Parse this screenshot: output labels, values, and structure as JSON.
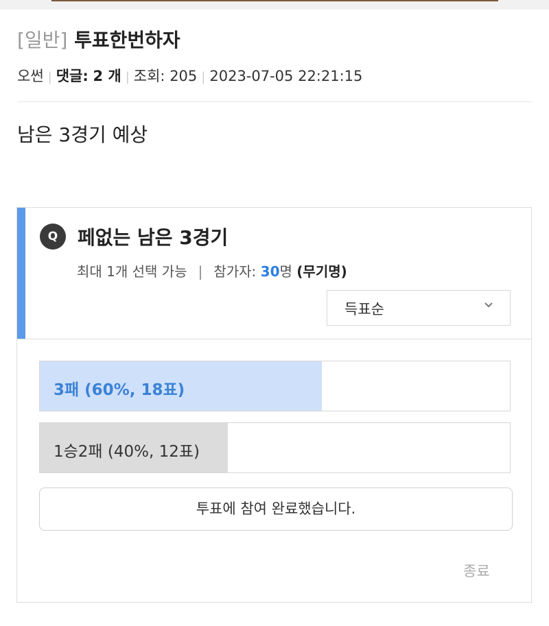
{
  "post": {
    "category": "[일반]",
    "title": "투표한번하자",
    "author": "오썬",
    "comments_label": "댓글:",
    "comments_count": "2 개",
    "views_label": "조회:",
    "views": "205",
    "datetime": "2023-07-05 22:21:15",
    "body": "남은 3경기 예상"
  },
  "poll": {
    "badge": "Q",
    "question": "페없는 남은 3경기",
    "max_select": "최대 1개 선택 가능",
    "divider": "|",
    "participants_label": "참가자:",
    "participants_count": "30",
    "participants_unit": "명",
    "anonymous": "(무기명)",
    "sort_selected": "득표순",
    "options": [
      {
        "label": "3패 (60%, 18표)",
        "percent": 60
      },
      {
        "label": "1승2패 (40%, 12표)",
        "percent": 40
      }
    ],
    "voted_button": "투표에 참여 완료했습니다.",
    "end_button": "종료"
  },
  "colors": {
    "accent": "#5b9ae8",
    "top_option_fill": "#cfe0fa",
    "top_option_text": "#3b82d6",
    "other_option_fill": "#dcdcdc",
    "participant_count": "#2a7fe0"
  },
  "icons": {
    "sort_dropdown": "chevron-down-icon"
  }
}
